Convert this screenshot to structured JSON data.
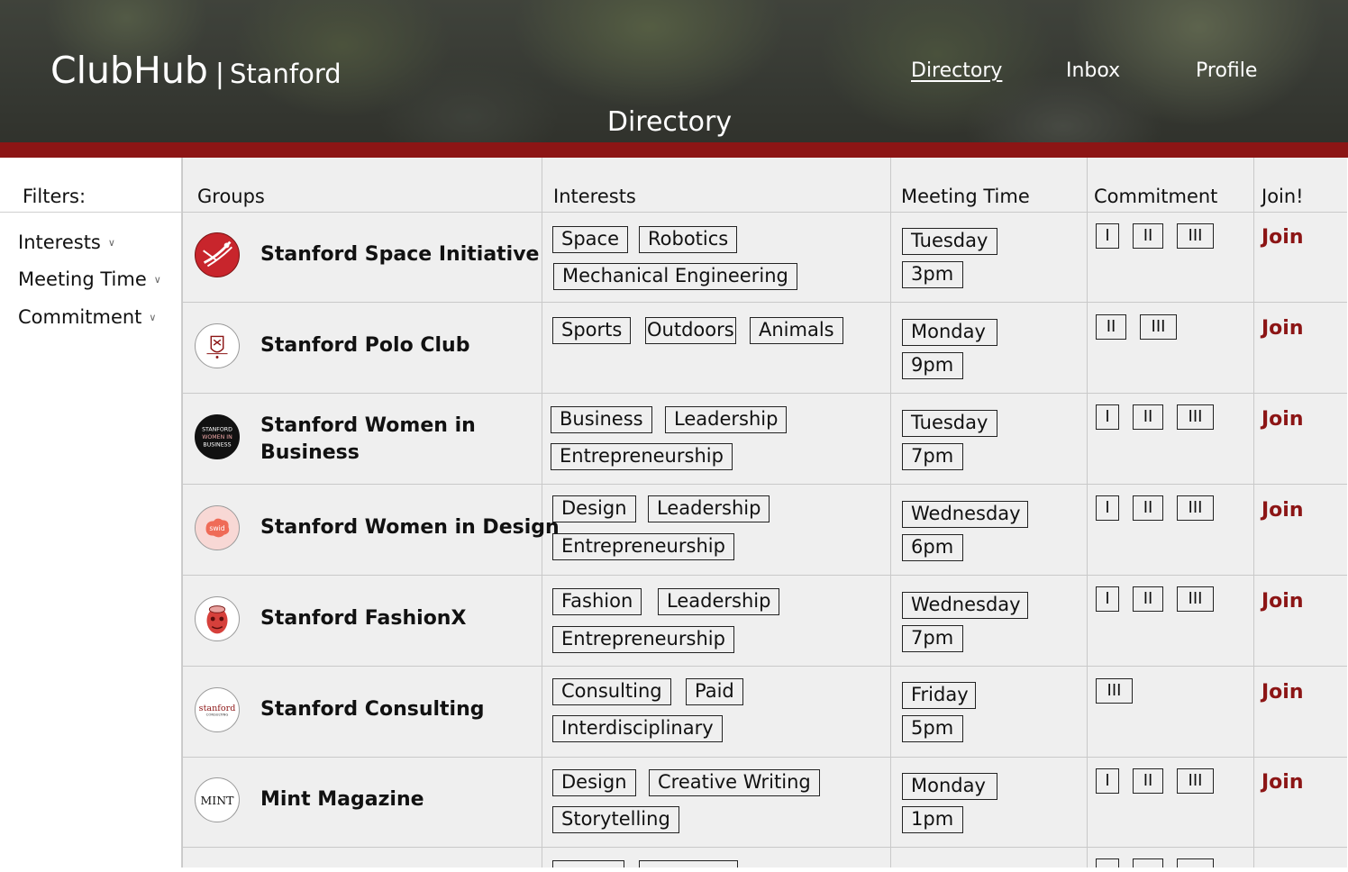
{
  "header": {
    "brand": "ClubHub",
    "separator": "|",
    "school": "Stanford",
    "nav": {
      "directory": "Directory",
      "inbox": "Inbox",
      "profile": "Profile"
    },
    "page_title": "Directory"
  },
  "sidebar": {
    "title": "Filters:",
    "filters": [
      {
        "label": "Interests",
        "icon": "chevron-down-icon"
      },
      {
        "label": "Meeting Time",
        "icon": "chevron-down-icon"
      },
      {
        "label": "Commitment",
        "icon": "chevron-down-icon"
      }
    ]
  },
  "table": {
    "columns": {
      "groups": "Groups",
      "interests": "Interests",
      "meeting_time": "Meeting Time",
      "commitment": "Commitment",
      "join": "Join!"
    },
    "rows": [
      {
        "name": "Stanford Space Initiative",
        "logo": "space-initiative-logo",
        "interests": [
          "Space",
          "Robotics",
          "Mechanical Engineering"
        ],
        "day": "Tuesday",
        "time": "3pm",
        "commitment": [
          "I",
          "II",
          "III"
        ],
        "join": "Join"
      },
      {
        "name": "Stanford Polo Club",
        "logo": "polo-club-logo",
        "interests": [
          "Sports",
          "Outdoors",
          "Animals"
        ],
        "day": "Monday",
        "time": "9pm",
        "commitment": [
          "II",
          "III"
        ],
        "join": "Join"
      },
      {
        "name": "Stanford Women in Business",
        "logo": "women-in-business-logo",
        "logo_text": [
          "STANFORD",
          "WOMEN IN",
          "BUSINESS"
        ],
        "interests": [
          "Business",
          "Leadership",
          "Entrepreneurship"
        ],
        "day": "Tuesday",
        "time": "7pm",
        "commitment": [
          "I",
          "II",
          "III"
        ],
        "join": "Join"
      },
      {
        "name": "Stanford Women in Design",
        "logo": "women-in-design-logo",
        "logo_text": "swid",
        "interests": [
          "Design",
          "Leadership",
          "Entrepreneurship"
        ],
        "day": "Wednesday",
        "time": "6pm",
        "commitment": [
          "I",
          "II",
          "III"
        ],
        "join": "Join"
      },
      {
        "name": "Stanford FashionX",
        "logo": "fashionx-logo",
        "interests": [
          "Fashion",
          "Leadership",
          "Entrepreneurship"
        ],
        "day": "Wednesday",
        "time": "7pm",
        "commitment": [
          "I",
          "II",
          "III"
        ],
        "join": "Join"
      },
      {
        "name": "Stanford Consulting",
        "logo": "consulting-logo",
        "logo_text": [
          "stanford",
          "CONSULTING"
        ],
        "interests": [
          "Consulting",
          "Paid",
          "Interdisciplinary"
        ],
        "day": "Friday",
        "time": "5pm",
        "commitment": [
          "III"
        ],
        "join": "Join"
      },
      {
        "name": "Mint Magazine",
        "logo": "mint-magazine-logo",
        "logo_text": "MINT",
        "interests": [
          "Design",
          "Creative Writing",
          "Storytelling"
        ],
        "day": "Monday",
        "time": "1pm",
        "commitment": [
          "I",
          "II",
          "III"
        ],
        "join": "Join"
      }
    ]
  },
  "colors": {
    "accent": "#8c1515",
    "table_bg": "#efefef"
  }
}
